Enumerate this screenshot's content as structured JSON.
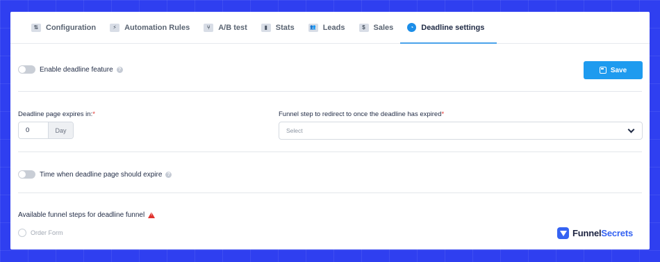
{
  "tabs": [
    {
      "label": "Configuration",
      "icon": "sliders-icon",
      "glyph": "⇅"
    },
    {
      "label": "Automation Rules",
      "icon": "bolt-icon",
      "glyph": "⚡"
    },
    {
      "label": "A/B test",
      "icon": "split-icon",
      "glyph": "⑂"
    },
    {
      "label": "Stats",
      "icon": "bar-chart-icon",
      "glyph": "▮"
    },
    {
      "label": "Leads",
      "icon": "users-icon",
      "glyph": "👥"
    },
    {
      "label": "Sales",
      "icon": "dollar-icon",
      "glyph": "$"
    },
    {
      "label": "Deadline settings",
      "icon": "clock-icon",
      "glyph": "◔",
      "active": true
    }
  ],
  "deadline_toggle": {
    "label": "Enable deadline feature",
    "enabled": false
  },
  "save_button": {
    "label": "Save",
    "color": "#1e9bef"
  },
  "expires_in": {
    "label": "Deadline page expires in:",
    "required_mark": "*",
    "value": "0",
    "unit": "Day"
  },
  "redirect_step": {
    "label": "Funnel step to redirect to once the deadline has expired",
    "required_mark": "*",
    "placeholder": "Select"
  },
  "time_toggle": {
    "label": "Time when deadline page should expire",
    "enabled": false
  },
  "available_steps": {
    "label": "Available funnel steps for deadline funnel",
    "warning_glyph": "!",
    "options": [
      {
        "label": "Order Form",
        "selected": false
      }
    ]
  },
  "brand": {
    "part1": "Funnel",
    "part2": "Secrets"
  },
  "colors": {
    "background": "#2f3ff0",
    "accent": "#1e9bef",
    "required": "#e0332e"
  }
}
